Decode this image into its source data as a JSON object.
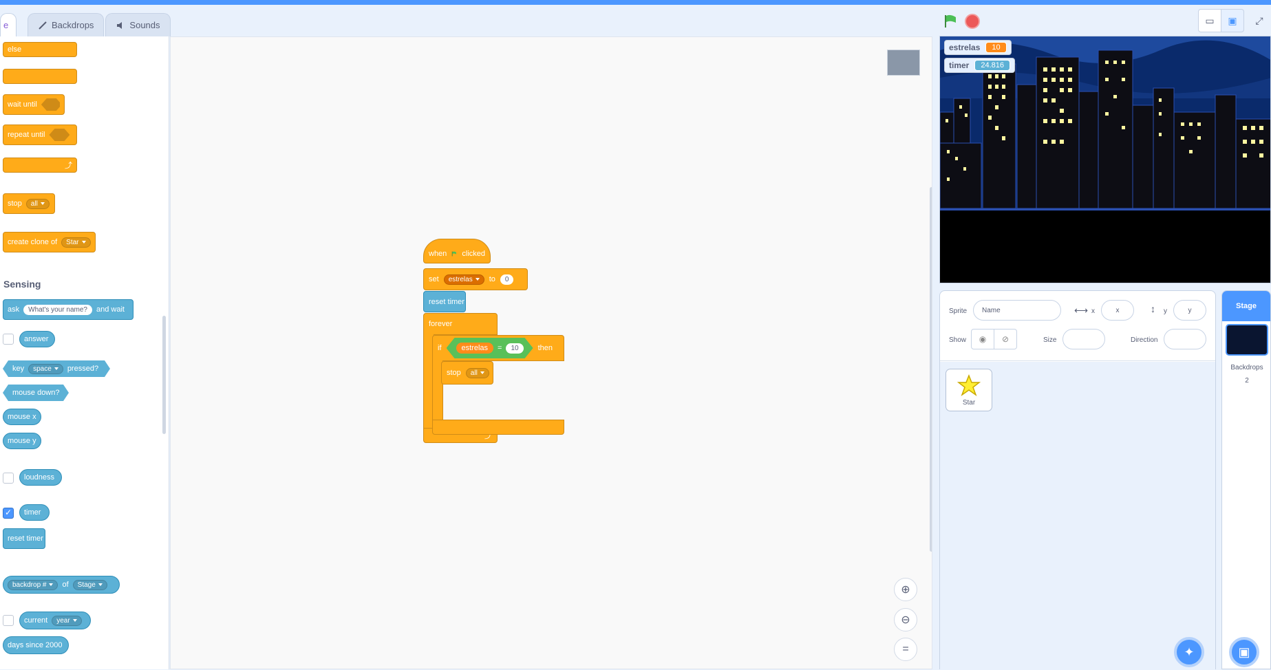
{
  "tabs": [
    {
      "label": "e"
    },
    {
      "label": "Backdrops"
    },
    {
      "label": "Sounds"
    }
  ],
  "palette": {
    "else": "else",
    "wait_until": "wait until",
    "repeat_until": "repeat until",
    "stop": "stop",
    "stop_option": "all",
    "create_clone": "create clone of",
    "create_clone_option": "Star",
    "category": "Sensing",
    "ask": "ask",
    "ask_default": "What's your name?",
    "and_wait": "and wait",
    "answer": "answer",
    "key": "key",
    "key_option": "space",
    "pressed": "pressed?",
    "mouse_down": "mouse down?",
    "mouse_x": "mouse x",
    "mouse_y": "mouse y",
    "loudness": "loudness",
    "timer": "timer",
    "reset_timer": "reset timer",
    "backdrop_option": "backdrop #",
    "of": "of",
    "of_option": "Stage",
    "current": "current",
    "current_option": "year",
    "days_since": "days since 2000"
  },
  "script": {
    "when": "when",
    "clicked": "clicked",
    "set": "set",
    "set_var": "estrelas",
    "to": "to",
    "set_value": "0",
    "reset_timer": "reset timer",
    "forever": "forever",
    "if": "if",
    "cond_var": "estrelas",
    "cond_op": "=",
    "cond_value": "10",
    "then": "then",
    "stop": "stop",
    "stop_option": "all"
  },
  "stage": {
    "monitors": [
      {
        "name": "estrelas",
        "value": "10"
      },
      {
        "name": "timer",
        "value": "24.816"
      }
    ]
  },
  "sprite_info": {
    "sprite_label": "Sprite",
    "name_placeholder": "Name",
    "x_label": "x",
    "x_placeholder": "x",
    "y_label": "y",
    "y_placeholder": "y",
    "show_label": "Show",
    "size_label": "Size",
    "direction_label": "Direction"
  },
  "sprites": [
    {
      "name": "Star"
    }
  ],
  "stage_pane": {
    "header": "Stage",
    "backdrops_label": "Backdrops",
    "backdrops_count": "2"
  },
  "colors": {
    "control": "#ffab19",
    "sensing": "#5cb1d6",
    "variable": "#ff8c1a",
    "operator": "#59c059",
    "accent": "#4c97ff"
  }
}
